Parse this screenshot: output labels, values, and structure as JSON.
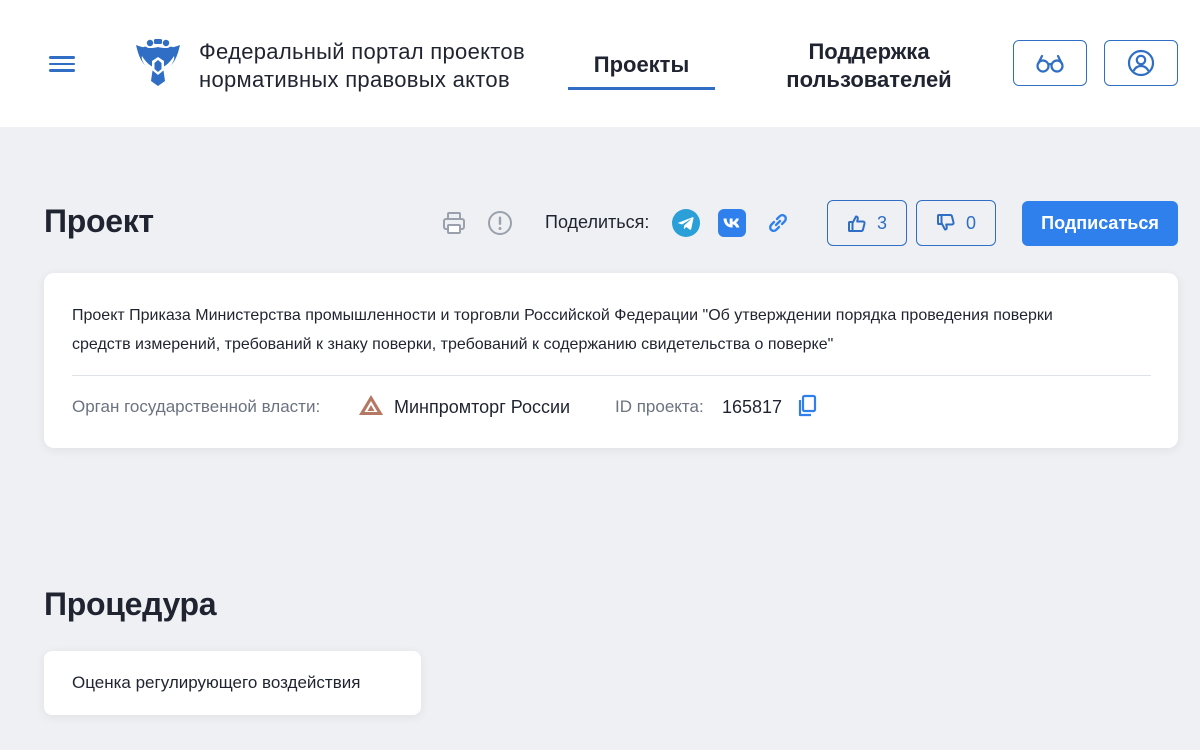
{
  "header": {
    "menu_icon": "hamburger-menu-icon",
    "emblem_icon": "russian-coat-of-arms-emblem",
    "portal_title_line1": "Федеральный портал проектов",
    "portal_title_line2": "нормативных правовых актов",
    "nav": {
      "projects": "Проекты",
      "support_line1": "Поддержка",
      "support_line2": "пользователей"
    },
    "buttons": {
      "accessibility_icon": "glasses-icon",
      "profile_icon": "user-circle-icon"
    },
    "accent_color": "#2f6ec4"
  },
  "project": {
    "title": "Проект",
    "toolbar": {
      "print_icon": "printer-icon",
      "report_icon": "exclamation-circle-icon",
      "share_label": "Поделиться:",
      "share_icons": [
        "telegram-icon",
        "vk-icon",
        "link-icon"
      ]
    },
    "likes": "3",
    "dislikes": "0",
    "subscribe_label": "Подписаться",
    "subscribe_color": "#2f80ed",
    "description_line1": "Проект Приказа Министерства промышленности и торговли Российской Федерации \"Об утверждении порядка проведения поверки",
    "description_line2": "средств измерений, требований к знаку поверки, требований к содержанию свидетельства о поверке\"",
    "authority_label": "Орган государственной власти:",
    "authority_value": "Минпромторг России",
    "id_label": "ID проекта:",
    "id_value": "165817"
  },
  "procedure": {
    "title": "Процедура",
    "stage": "Оценка регулирующего воздействия"
  }
}
